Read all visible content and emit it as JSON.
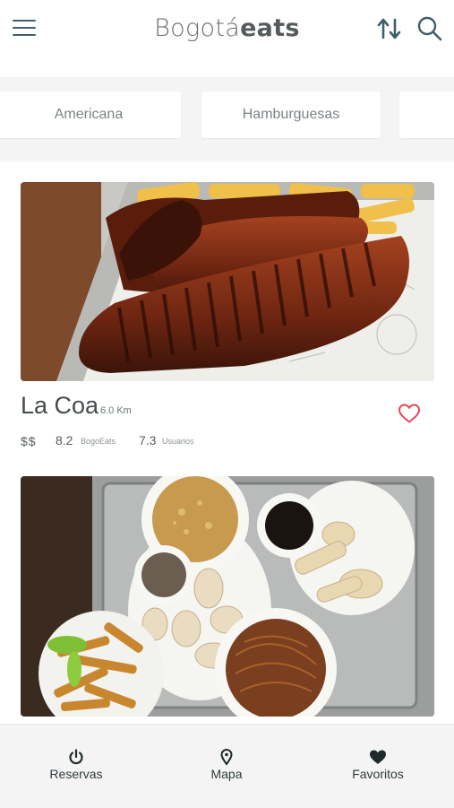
{
  "header": {
    "logo_light": "Bogotá",
    "logo_bold": "eats"
  },
  "categories": [
    {
      "label": "Americana"
    },
    {
      "label": "Hamburguesas"
    },
    {
      "label": ""
    }
  ],
  "restaurants": [
    {
      "name": "La Coa",
      "distance": "6.0 Km",
      "price": "$$",
      "score_bogoeats": "8.2",
      "score_bogoeats_label": "BogoEats",
      "score_users": "7.3",
      "score_users_label": "Usuarios",
      "favorite_color": "#e4445a"
    },
    {
      "name": ""
    }
  ],
  "tabbar": {
    "reservas": "Reservas",
    "mapa": "Mapa",
    "favoritos": "Favoritos"
  },
  "icons": {
    "menu": "hamburger-menu-icon",
    "sort": "sort-arrows-icon",
    "search": "search-icon",
    "heart": "heart-outline-icon",
    "power": "power-icon",
    "pin": "map-pin-icon",
    "heart_filled": "heart-filled-icon"
  },
  "colors": {
    "accent": "#e4445a",
    "icon_teal": "#3f5f6b"
  }
}
